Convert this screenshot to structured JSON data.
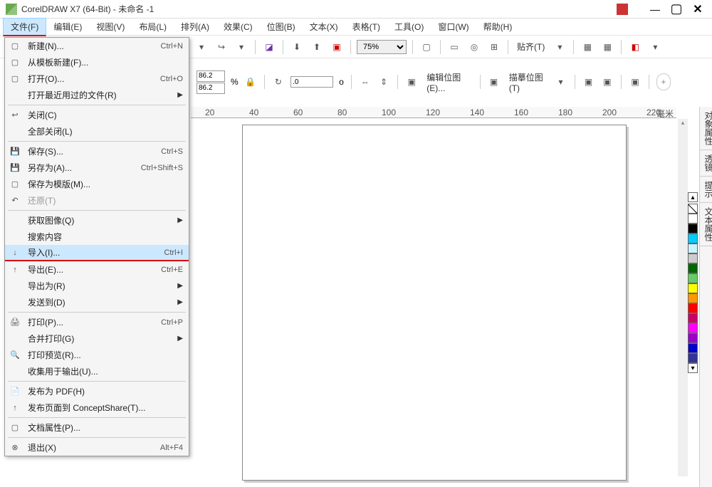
{
  "window": {
    "title": "CorelDRAW X7 (64-Bit) - 未命名 -1"
  },
  "menubar": [
    {
      "label": "文件(F)",
      "active": true
    },
    {
      "label": "编辑(E)"
    },
    {
      "label": "视图(V)"
    },
    {
      "label": "布局(L)"
    },
    {
      "label": "排列(A)"
    },
    {
      "label": "效果(C)"
    },
    {
      "label": "位图(B)"
    },
    {
      "label": "文本(X)"
    },
    {
      "label": "表格(T)"
    },
    {
      "label": "工具(O)"
    },
    {
      "label": "窗口(W)"
    },
    {
      "label": "帮助(H)"
    }
  ],
  "toolbar": {
    "zoom": "75%",
    "align_label": "贴齐(T)",
    "num1": "86.2",
    "num2": "86.2",
    "pct": "%",
    "rotate": ".0",
    "rot_unit": "o",
    "edit_bitmap": "编辑位图(E)...",
    "trace_bitmap": "描摹位图(T)"
  },
  "file_menu": [
    {
      "icon": "▢",
      "label": "新建(N)...",
      "shortcut": "Ctrl+N"
    },
    {
      "icon": "▢",
      "label": "从模板新建(F)...",
      "shortcut": ""
    },
    {
      "icon": "▢",
      "label": "打开(O)...",
      "shortcut": "Ctrl+O"
    },
    {
      "icon": "",
      "label": "打开最近用过的文件(R)",
      "shortcut": "",
      "arrow": true
    },
    {
      "sep": true
    },
    {
      "icon": "↩",
      "label": "关闭(C)",
      "shortcut": ""
    },
    {
      "icon": "",
      "label": "全部关闭(L)",
      "shortcut": ""
    },
    {
      "sep": true
    },
    {
      "icon": "💾",
      "label": "保存(S)...",
      "shortcut": "Ctrl+S"
    },
    {
      "icon": "💾",
      "label": "另存为(A)...",
      "shortcut": "Ctrl+Shift+S"
    },
    {
      "icon": "▢",
      "label": "保存为模版(M)...",
      "shortcut": ""
    },
    {
      "icon": "↶",
      "label": "还原(T)",
      "shortcut": "",
      "disabled": true
    },
    {
      "sep": true
    },
    {
      "icon": "",
      "label": "获取图像(Q)",
      "shortcut": "",
      "arrow": true
    },
    {
      "icon": "",
      "label": "搜索内容",
      "shortcut": ""
    },
    {
      "icon": "↓",
      "label": "导入(I)...",
      "shortcut": "Ctrl+I",
      "highlight": true
    },
    {
      "icon": "↑",
      "label": "导出(E)...",
      "shortcut": "Ctrl+E"
    },
    {
      "icon": "",
      "label": "导出为(R)",
      "shortcut": "",
      "arrow": true
    },
    {
      "icon": "",
      "label": "发送到(D)",
      "shortcut": "",
      "arrow": true
    },
    {
      "sep": true
    },
    {
      "icon": "🖨",
      "label": "打印(P)...",
      "shortcut": "Ctrl+P"
    },
    {
      "icon": "",
      "label": "合并打印(G)",
      "shortcut": "",
      "arrow": true
    },
    {
      "icon": "🔍",
      "label": "打印预览(R)...",
      "shortcut": ""
    },
    {
      "icon": "",
      "label": "收集用于输出(U)...",
      "shortcut": ""
    },
    {
      "sep": true
    },
    {
      "icon": "📄",
      "label": "发布为 PDF(H)",
      "shortcut": ""
    },
    {
      "icon": "↑",
      "label": "发布页面到 ConceptShare(T)...",
      "shortcut": ""
    },
    {
      "sep": true
    },
    {
      "icon": "▢",
      "label": "文档属性(P)...",
      "shortcut": ""
    },
    {
      "sep": true
    },
    {
      "icon": "⊗",
      "label": "退出(X)",
      "shortcut": "Alt+F4"
    }
  ],
  "ruler_marks": [
    "20",
    "40",
    "60",
    "80",
    "100",
    "120",
    "140",
    "160",
    "180",
    "200",
    "220"
  ],
  "ruler_unit": "毫米",
  "right_tabs": [
    {
      "icon": "✦",
      "label": "对象属性"
    },
    {
      "icon": "○",
      "label": "透镜"
    },
    {
      "icon": "↗",
      "label": "提示"
    },
    {
      "icon": "A",
      "label": "文本属性"
    }
  ],
  "colors": [
    "#ffffff",
    "#000000",
    "#00ccff",
    "#ccf2ff",
    "#cccccc",
    "#006600",
    "#66cc66",
    "#ffff00",
    "#ff9900",
    "#ff0000",
    "#cc0066",
    "#ff00ff",
    "#9900cc",
    "#0000cc",
    "#333399"
  ]
}
